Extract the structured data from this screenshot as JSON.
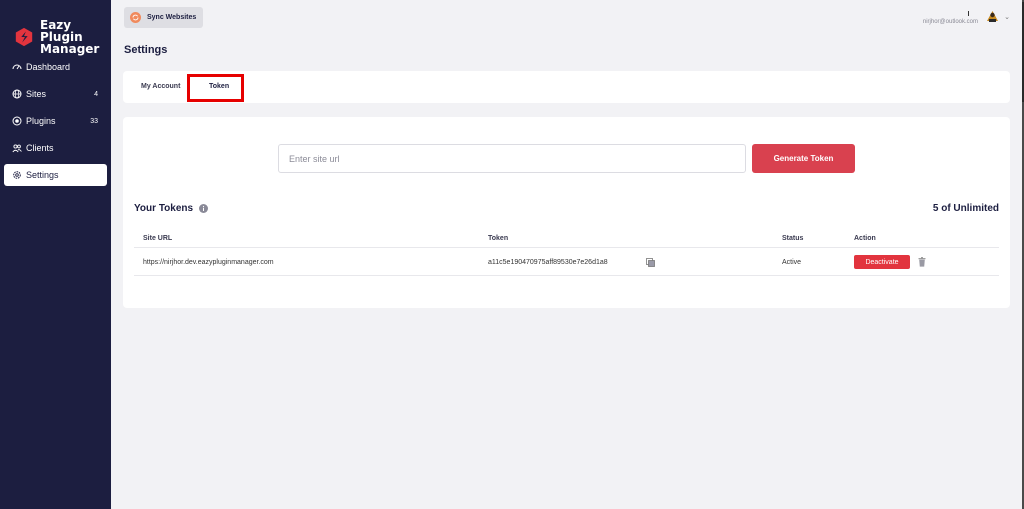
{
  "brand": {
    "line1": "Eazy Plugin",
    "line2": "Manager",
    "color": "#e2343e"
  },
  "sidebar": {
    "items": [
      {
        "label": "Dashboard",
        "icon": "dashboard-icon",
        "count": ""
      },
      {
        "label": "Sites",
        "icon": "globe-icon",
        "count": "4"
      },
      {
        "label": "Plugins",
        "icon": "plugin-icon",
        "count": "33"
      },
      {
        "label": "Clients",
        "icon": "users-icon",
        "count": ""
      },
      {
        "label": "Settings",
        "icon": "gear-icon",
        "count": "",
        "active": true
      }
    ]
  },
  "topbar": {
    "sync_label": "Sync Websites",
    "user_email": "nirjhor@outlook.com"
  },
  "page": {
    "title": "Settings"
  },
  "tabs": [
    {
      "label": "My Account",
      "active": false
    },
    {
      "label": "Token",
      "active": true
    }
  ],
  "token_form": {
    "placeholder": "Enter site url",
    "value": "",
    "button_label": "Generate Token"
  },
  "tokens": {
    "title": "Your Tokens",
    "quota": "5 of Unlimited",
    "columns": [
      "Site URL",
      "Token",
      "Status",
      "Action"
    ],
    "rows": [
      {
        "site_url": "https://nirjhor.dev.eazypluginmanager.com",
        "token": "a11c5e190470975aff89530e7e26d1a8",
        "status": "Active",
        "action_label": "Deactivate"
      }
    ]
  },
  "colors": {
    "sidebar_bg": "#1c1e40",
    "accent_red": "#d9414f",
    "deactivate_red": "#e2343e",
    "highlight": "#e60000"
  }
}
